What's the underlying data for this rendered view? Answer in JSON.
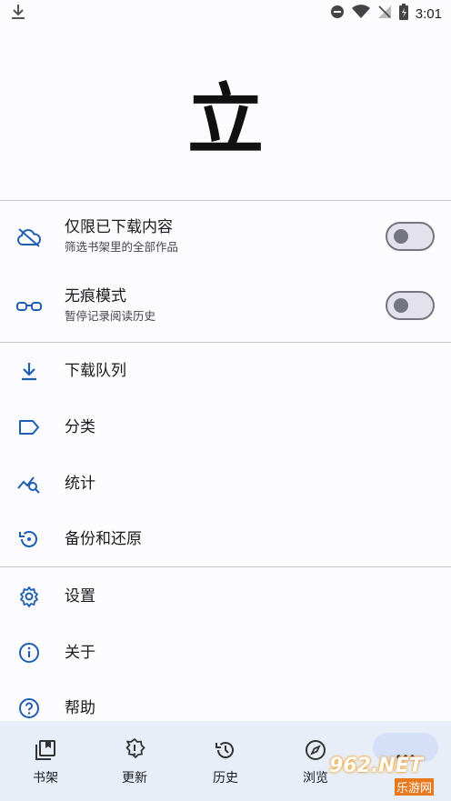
{
  "status_bar": {
    "time": "3:01"
  },
  "header": {
    "logo_text": "立"
  },
  "toggles": [
    {
      "title": "仅限已下载内容",
      "subtitle": "筛选书架里的全部作品",
      "on": false
    },
    {
      "title": "无痕模式",
      "subtitle": "暂停记录阅读历史",
      "on": false
    }
  ],
  "menu": [
    {
      "label": "下载队列"
    },
    {
      "label": "分类"
    },
    {
      "label": "统计"
    },
    {
      "label": "备份和还原"
    }
  ],
  "menu2": [
    {
      "label": "设置"
    },
    {
      "label": "关于"
    },
    {
      "label": "帮助"
    }
  ],
  "bottom_nav": [
    {
      "label": "书架"
    },
    {
      "label": "更新"
    },
    {
      "label": "历史"
    },
    {
      "label": "浏览"
    }
  ],
  "watermark": {
    "text": "962.NET",
    "sub": "乐游网"
  },
  "colors": {
    "accent": "#1e5fb4",
    "icon": "#1e5fb4",
    "nav_bg": "#e8eef8"
  }
}
